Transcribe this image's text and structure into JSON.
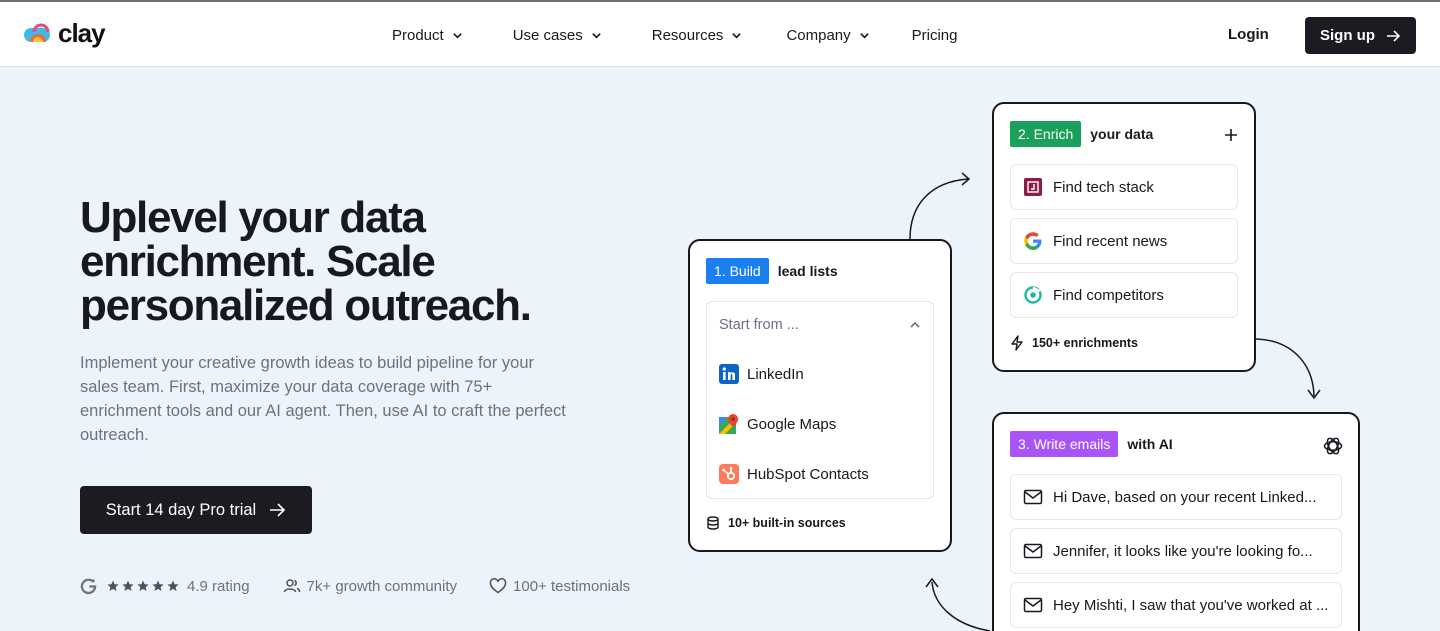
{
  "nav": {
    "logo_text": "clay",
    "menu": [
      {
        "label": "Product",
        "dropdown": true
      },
      {
        "label": "Use cases",
        "dropdown": true
      },
      {
        "label": "Resources",
        "dropdown": true
      },
      {
        "label": "Company",
        "dropdown": true
      },
      {
        "label": "Pricing",
        "dropdown": false
      }
    ],
    "login": "Login",
    "signup": "Sign up"
  },
  "hero": {
    "headline": "Uplevel your data enrichment. Scale personalized outreach.",
    "subheadline": "Implement your creative growth ideas to build pipeline for your sales team. First, maximize your data coverage with 75+ enrichment tools and our AI agent. Then, use AI to craft the perfect outreach.",
    "cta": "Start 14 day Pro trial",
    "stats": {
      "rating": "4.9 rating",
      "community": "7k+ growth community",
      "testimonials": "100+ testimonials"
    },
    "rating_stars": 5
  },
  "build_card": {
    "tag": "1. Build",
    "title": "lead lists",
    "dropdown_placeholder": "Start from ...",
    "sources": [
      "LinkedIn",
      "Google Maps",
      "HubSpot Contacts"
    ],
    "footer": "10+ built-in sources"
  },
  "enrich_card": {
    "tag": "2. Enrich",
    "title": "your data",
    "items": [
      "Find tech stack",
      "Find recent news",
      "Find competitors"
    ],
    "footer": "150+ enrichments"
  },
  "write_card": {
    "tag": "3. Write emails",
    "title": "with AI",
    "emails": [
      "Hi Dave, based on your recent Linked...",
      "Jennifer, it looks like you're looking fo...",
      "Hey Mishti, I saw that you've worked at ..."
    ]
  },
  "colors": {
    "build_tag": "#1a7ff0",
    "enrich_tag": "#1aa05a",
    "write_tag": "#a855f7",
    "dark": "#1a1c21",
    "background": "#edf3fb"
  }
}
